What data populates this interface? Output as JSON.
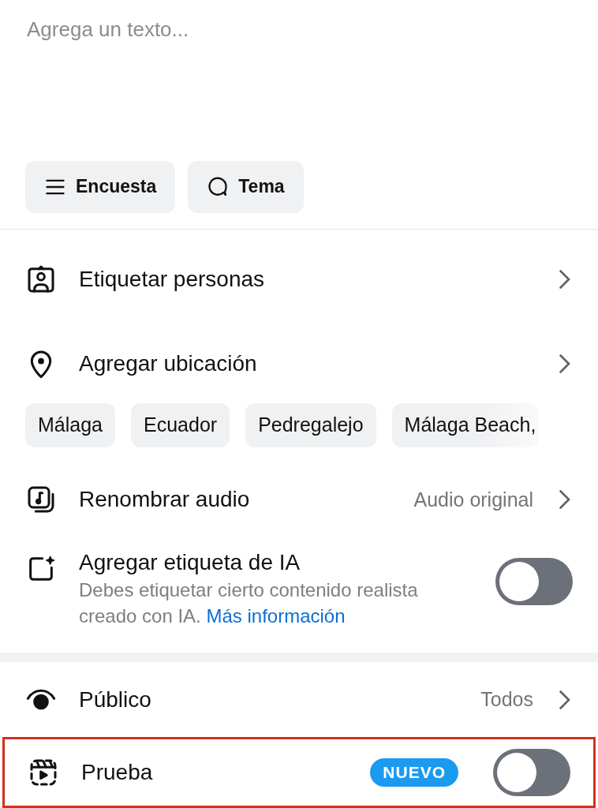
{
  "composer": {
    "placeholder": "Agrega un texto..."
  },
  "actions": [
    {
      "kind": "poll",
      "label": "Encuesta"
    },
    {
      "kind": "topic",
      "label": "Tema"
    }
  ],
  "rows": [
    {
      "kind": "tag",
      "label": "Etiquetar personas"
    },
    {
      "kind": "location",
      "label": "Agregar ubicación"
    }
  ],
  "location_chips": [
    "Málaga",
    "Ecuador",
    "Pedregalejo",
    "Málaga Beach,"
  ],
  "audio": {
    "label": "Renombrar audio",
    "value": "Audio original"
  },
  "ai_label": {
    "label": "Agregar etiqueta de IA",
    "description": "Debes etiquetar cierto contenido realista creado con IA.",
    "link": "Más información",
    "on": false
  },
  "audience": {
    "label": "Público",
    "value": "Todos"
  },
  "trial": {
    "label": "Prueba",
    "badge": "NUEVO",
    "on": false,
    "highlighted": true
  }
}
